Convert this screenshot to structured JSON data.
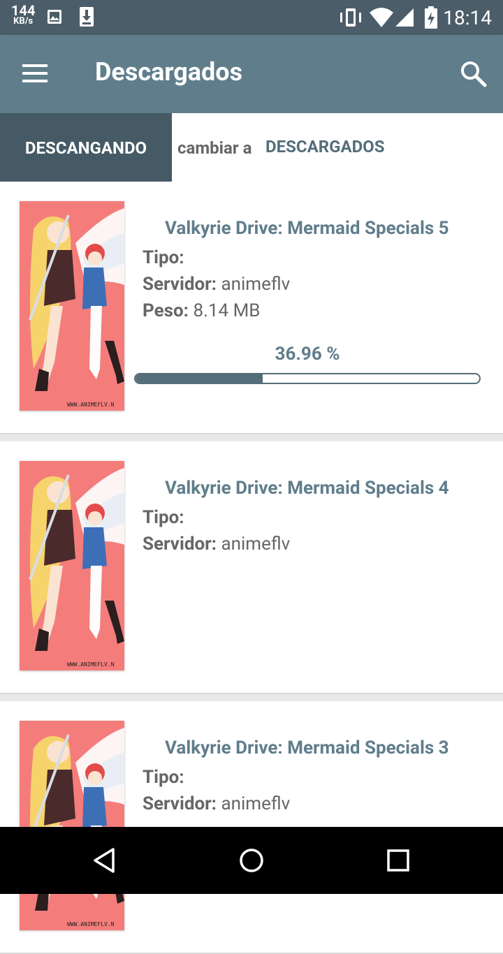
{
  "status_bar": {
    "speed_value": "144",
    "speed_unit": "KB/s",
    "time": "18:14",
    "icons": [
      "image-icon",
      "download-icon",
      "vibrate-icon",
      "wifi-icon",
      "signal-icon",
      "battery-icon"
    ]
  },
  "app_bar": {
    "title": "Descargados",
    "icons": [
      "menu-icon",
      "search-icon"
    ]
  },
  "toggle": {
    "active_label": "DESCANGANDO",
    "switch_text": "cambiar a",
    "switch_link": "DESCARGADOS"
  },
  "labels": {
    "tipo": "Tipo:",
    "servidor": "Servidor:",
    "peso": "Peso:"
  },
  "items": [
    {
      "name": "Valkyrie Drive: Mermaid Specials 5",
      "tipo": "",
      "servidor": "animeflv",
      "peso": "8.14 MB",
      "progress_text": "36.96 %",
      "progress": 0.3696
    },
    {
      "name": "Valkyrie Drive: Mermaid Specials 4",
      "tipo": "",
      "servidor": "animeflv"
    },
    {
      "name": "Valkyrie Drive: Mermaid Specials 3",
      "tipo": "",
      "servidor": "animeflv"
    }
  ],
  "nav": {
    "icons": [
      "back-icon",
      "home-icon",
      "recents-icon"
    ]
  },
  "colors": {
    "primary": "#607d8b",
    "primary_dark": "#455a64",
    "status_bar": "#4b5d68",
    "thumb_bg": "#f47d7c"
  }
}
